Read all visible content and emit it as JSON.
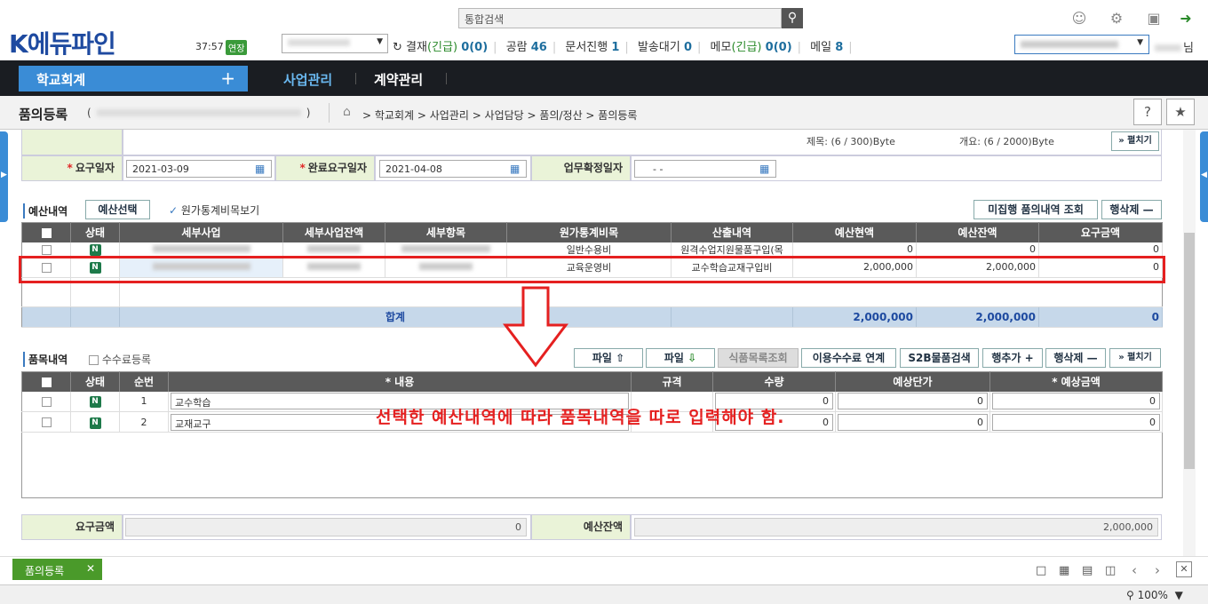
{
  "header": {
    "logo": "K에듀파인",
    "timer": "37:57",
    "extend_label": "연장",
    "search_placeholder": "통합검색",
    "status": {
      "approval_label": "결재",
      "approval_urgent": "(긴급)",
      "approval_count": "0(0)",
      "notice_label": "공람",
      "notice_count": "46",
      "doc_label": "문서진행",
      "doc_count": "1",
      "send_label": "발송대기",
      "send_count": "0",
      "memo_label": "메모",
      "memo_urgent": "(긴급)",
      "memo_count": "0(0)",
      "mail_label": "메일",
      "mail_count": "8"
    },
    "user_suffix": "님"
  },
  "nav": {
    "active_tab": "학교회계",
    "items": [
      "사업관리",
      "계약관리"
    ]
  },
  "title": {
    "text": "품의등록",
    "paren_open": "(",
    "paren_close": ")",
    "breadcrumb": "> 학교회계 > 사업관리 > 사업담당 > 품의/정산 > 품의등록"
  },
  "form": {
    "title_bytes": "제목: (6 / 300)Byte",
    "summary_bytes": "개요: (6 / 2000)Byte",
    "expand_label": "펼치기",
    "request_date_label": "요구일자",
    "request_date": "2021-03-09",
    "complete_date_label": "완료요구일자",
    "complete_date": "2021-04-08",
    "confirm_date_label": "업무확정일자",
    "confirm_date": "- -"
  },
  "budget": {
    "section_title": "예산내역",
    "select_button": "예산선택",
    "cost_check_label": "원가통계비목보기",
    "unexec_button": "미집행 품의내역 조회",
    "delete_row_button": "행삭제",
    "columns": [
      "상태",
      "세부사업",
      "세부사업잔액",
      "세부항목",
      "원가통계비목",
      "산출내역",
      "예산현액",
      "예산잔액",
      "요구금액"
    ],
    "rows": [
      {
        "status": "N",
        "cost_item": "일반수용비",
        "calc": "원격수업지원물품구입(목",
        "budget_now": "0",
        "budget_left": "0",
        "request": "0"
      },
      {
        "status": "N",
        "cost_item": "교육운영비",
        "calc": "교수학습교재구입비",
        "budget_now": "2,000,000",
        "budget_left": "2,000,000",
        "request": "0"
      }
    ],
    "total_label": "합계",
    "total_now": "2,000,000",
    "total_left": "2,000,000",
    "total_request": "0"
  },
  "items": {
    "section_title": "품목내역",
    "fee_check_label": "수수료등록",
    "file_up_button": "파일",
    "file_down_button": "파일",
    "food_button": "식품목록조회",
    "fee_link_button": "이용수수료 연계",
    "s2b_button": "S2B물품검색",
    "add_row_button": "행추가",
    "del_row_button": "행삭제",
    "expand_button": "펼치기",
    "columns": [
      "상태",
      "순번",
      "* 내용",
      "규격",
      "수량",
      "예상단가",
      "* 예상금액"
    ],
    "rows": [
      {
        "status": "N",
        "seq": "1",
        "content": "교수학습",
        "qty": "0",
        "unit_price": "0",
        "amount": "0"
      },
      {
        "status": "N",
        "seq": "2",
        "content": "교재교구",
        "qty": "0",
        "unit_price": "0",
        "amount": "0"
      }
    ]
  },
  "summary": {
    "request_amount_label": "요구금액",
    "request_amount": "0",
    "budget_left_label": "예산잔액",
    "budget_left": "2,000,000"
  },
  "annotation": {
    "text": "선택한 예산내역에 따라 품목내역을 따로 입력해야 함."
  },
  "footer": {
    "tab_label": "품의등록",
    "zoom": "100%"
  },
  "colors": {
    "accent": "#3a8cd6",
    "annotation": "#e52020",
    "label_bg": "#eaf3d8",
    "header_dark": "#1a1d22"
  }
}
